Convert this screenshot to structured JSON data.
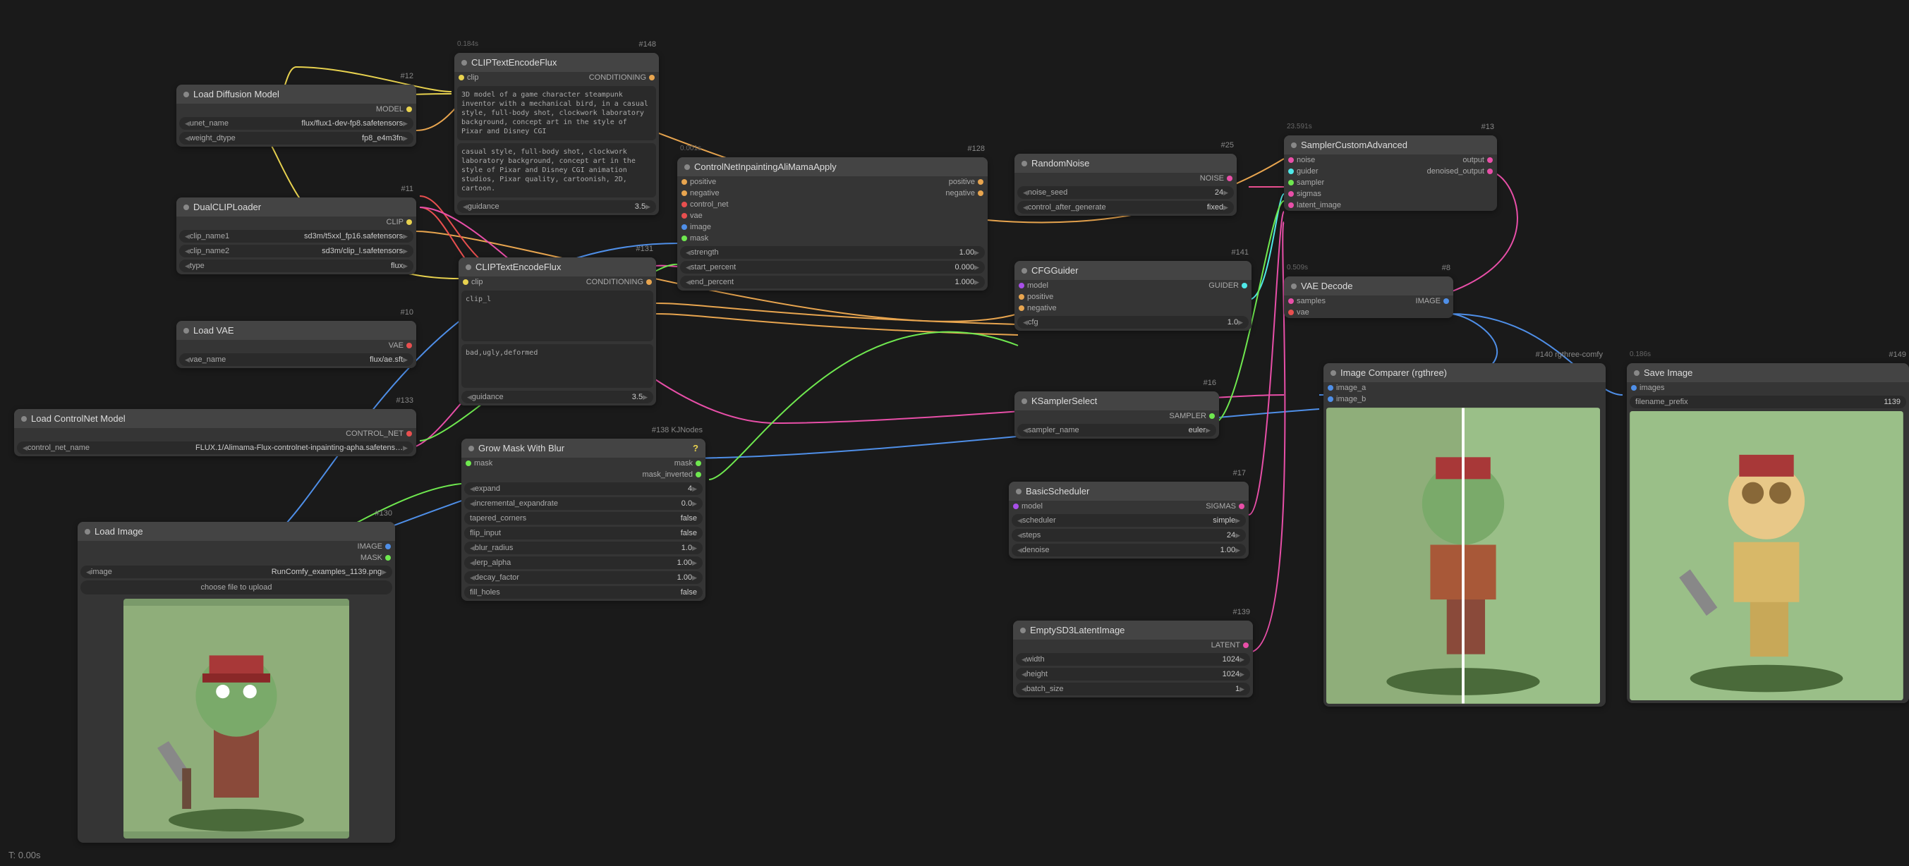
{
  "status": "T: 0.00s",
  "nodes": {
    "loadDiffusion": {
      "id": "#12",
      "title": "Load Diffusion Model",
      "out": "MODEL",
      "w1l": "unet_name",
      "w1v": "flux/flux1-dev-fp8.safetensors",
      "w2l": "weight_dtype",
      "w2v": "fp8_e4m3fn"
    },
    "dualClip": {
      "id": "#11",
      "title": "DualCLIPLoader",
      "out": "CLIP",
      "w1l": "clip_name1",
      "w1v": "sd3m/t5xxl_fp16.safetensors",
      "w2l": "clip_name2",
      "w2v": "sd3m/clip_l.safetensors",
      "w3l": "type",
      "w3v": "flux"
    },
    "loadVae": {
      "id": "#10",
      "title": "Load VAE",
      "out": "VAE",
      "w1l": "vae_name",
      "w1v": "flux/ae.sft"
    },
    "loadControlNet": {
      "id": "#133",
      "title": "Load ControlNet Model",
      "out": "CONTROL_NET",
      "w1l": "control_net_name",
      "w1v": "FLUX.1/Alimama-Flux-controlnet-inpainting-apha.safetens…"
    },
    "loadImage": {
      "id": "#130",
      "title": "Load Image",
      "out1": "IMAGE",
      "out2": "MASK",
      "w1l": "image",
      "w1v": "RunComfy_examples_1139.png",
      "btn": "choose file to upload"
    },
    "clipEncode1": {
      "id": "#148",
      "time": "0.184s",
      "title": "CLIPTextEncodeFlux",
      "in": "clip",
      "out": "CONDITIONING",
      "text1": "3D model of a game character steampunk inventor with a mechanical bird, in a casual style, full-body shot, clockwork laboratory background, concept art in the style of Pixar and Disney CGI",
      "text2": "casual style, full-body shot, clockwork laboratory background, concept art in the style of Pixar and Disney CGI animation studios, Pixar quality, cartoonish, 2D, cartoon.",
      "wgl": "guidance",
      "wgv": "3.5"
    },
    "clipEncode2": {
      "id": "#131",
      "title": "CLIPTextEncodeFlux",
      "in": "clip",
      "out": "CONDITIONING",
      "text1": "clip_l",
      "text2": "bad,ugly,deformed",
      "wgl": "guidance",
      "wgv": "3.5"
    },
    "growMask": {
      "id": "#138 KJNodes",
      "title": "Grow Mask With Blur",
      "in": "mask",
      "out1": "mask",
      "out2": "mask_inverted",
      "w1l": "expand",
      "w1v": "4",
      "w2l": "incremental_expandrate",
      "w2v": "0.0",
      "w3l": "tapered_corners",
      "w3v": "false",
      "w4l": "flip_input",
      "w4v": "false",
      "w5l": "blur_radius",
      "w5v": "1.0",
      "w6l": "lerp_alpha",
      "w6v": "1.00",
      "w7l": "decay_factor",
      "w7v": "1.00",
      "w8l": "fill_holes",
      "w8v": "false"
    },
    "controlNetInpaint": {
      "id": "#128",
      "time": "0.001s",
      "title": "ControlNetInpaintingAliMamaApply",
      "ins": [
        "positive",
        "negative",
        "control_net",
        "vae",
        "image",
        "mask"
      ],
      "outs": [
        "positive",
        "negative"
      ],
      "w1l": "strength",
      "w1v": "1.00",
      "w2l": "start_percent",
      "w2v": "0.000",
      "w3l": "end_percent",
      "w3v": "1.000"
    },
    "randomNoise": {
      "id": "#25",
      "title": "RandomNoise",
      "out": "NOISE",
      "w1l": "noise_seed",
      "w1v": "24",
      "w2l": "control_after_generate",
      "w2v": "fixed"
    },
    "cfgGuider": {
      "id": "#141",
      "title": "CFGGuider",
      "ins": [
        "model",
        "positive",
        "negative"
      ],
      "out": "GUIDER",
      "w1l": "cfg",
      "w1v": "1.0"
    },
    "ksampler": {
      "id": "#16",
      "title": "KSamplerSelect",
      "out": "SAMPLER",
      "w1l": "sampler_name",
      "w1v": "euler"
    },
    "basicScheduler": {
      "id": "#17",
      "title": "BasicScheduler",
      "in": "model",
      "out": "SIGMAS",
      "w1l": "scheduler",
      "w1v": "simple",
      "w2l": "steps",
      "w2v": "24",
      "w3l": "denoise",
      "w3v": "1.00"
    },
    "emptyLatent": {
      "id": "#139",
      "title": "EmptySD3LatentImage",
      "out": "LATENT",
      "w1l": "width",
      "w1v": "1024",
      "w2l": "height",
      "w2v": "1024",
      "w3l": "batch_size",
      "w3v": "1"
    },
    "samplerCustom": {
      "id": "#13",
      "time": "23.591s",
      "title": "SamplerCustomAdvanced",
      "ins": [
        "noise",
        "guider",
        "sampler",
        "sigmas",
        "latent_image"
      ],
      "outs": [
        "output",
        "denoised_output"
      ]
    },
    "vaeDecode": {
      "id": "#8",
      "time": "0.509s",
      "title": "VAE Decode",
      "ins": [
        "samples",
        "vae"
      ],
      "out": "IMAGE"
    },
    "imageCompare": {
      "id": "#140 rgthree-comfy",
      "title": "Image Comparer (rgthree)",
      "ins": [
        "image_a",
        "image_b"
      ]
    },
    "saveImage": {
      "id": "#149",
      "time": "0.186s",
      "title": "Save Image",
      "in": "images",
      "w1l": "filename_prefix",
      "w1v": "1139"
    }
  }
}
